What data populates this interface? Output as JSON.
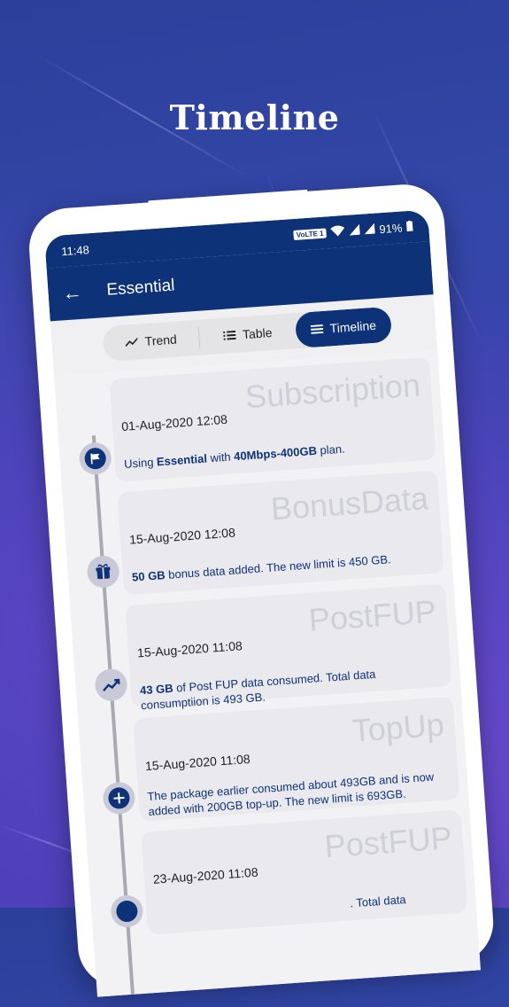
{
  "headline": "Timeline",
  "status": {
    "time": "11:48",
    "volte": "VoLTE 1",
    "battery": "91%"
  },
  "appbar": {
    "title": "Essential"
  },
  "tabs": [
    {
      "label": "Trend",
      "icon": "trend-icon",
      "active": false
    },
    {
      "label": "Table",
      "icon": "list-icon",
      "active": false
    },
    {
      "label": "Timeline",
      "icon": "menu-icon",
      "active": true
    }
  ],
  "entries": [
    {
      "type": "Subscription",
      "date": "01-Aug-2020 12:08",
      "icon": "flag-icon",
      "parts": [
        "Using ",
        "Essential",
        " with ",
        "40Mbps-400GB",
        " plan."
      ]
    },
    {
      "type": "BonusData",
      "date": "15-Aug-2020 12:08",
      "icon": "gift-icon",
      "parts": [
        "",
        "50 GB",
        " bonus data added. The new limit is 450 GB."
      ]
    },
    {
      "type": "PostFUP",
      "date": "15-Aug-2020 11:08",
      "icon": "trending-up-icon",
      "parts": [
        "",
        "43 GB",
        " of Post FUP data consumed. Total data consumptiion is 493 GB."
      ]
    },
    {
      "type": "TopUp",
      "date": "15-Aug-2020 11:08",
      "icon": "plus-circle-icon",
      "parts": [
        "The package earlier consumed about 493GB and is now added with 200GB top-up. The new limit is 693GB."
      ]
    },
    {
      "type": "PostFUP",
      "date": "23-Aug-2020 11:08",
      "icon": "trending-up-icon",
      "parts": [
        "",
        "",
        ". Total data"
      ]
    }
  ]
}
